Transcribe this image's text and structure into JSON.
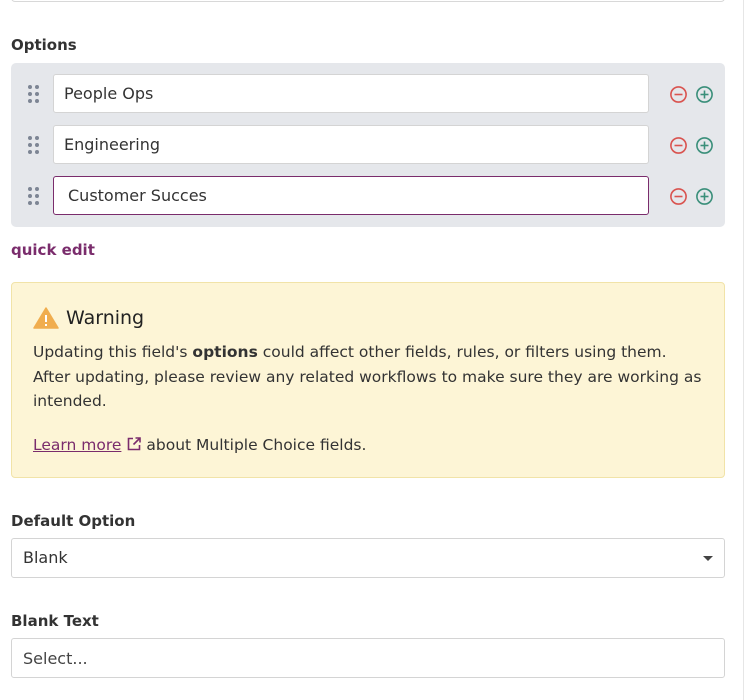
{
  "options": {
    "label": "Options",
    "items": [
      {
        "value": "People Ops"
      },
      {
        "value": "Engineering"
      },
      {
        "value": "Customer Succes"
      }
    ],
    "remove_icon": "minus-circle-icon",
    "add_icon": "plus-circle-icon",
    "drag_icon": "drag-handle-icon",
    "quick_edit_label": "quick edit"
  },
  "warning": {
    "icon": "warning-triangle-icon",
    "title": "Warning",
    "text_before": "Updating this field's ",
    "text_bold": "options",
    "text_after": " could affect other fields, rules, or filters using them. After updating, please review any related workflows to make sure they are working as intended.",
    "learn_more_label": "Learn more",
    "learn_more_icon": "external-link-icon",
    "learn_more_suffix": "about Multiple Choice fields."
  },
  "default_option": {
    "label": "Default Option",
    "selected": "Blank",
    "caret_icon": "caret-down-icon"
  },
  "blank_text": {
    "label": "Blank Text",
    "placeholder": "Select..."
  },
  "colors": {
    "accent": "#7a2c6c",
    "remove": "#d9534f",
    "add": "#3a8f7a",
    "warning_bg": "#fdf5d6",
    "warning_icon": "#f0ad4e"
  }
}
